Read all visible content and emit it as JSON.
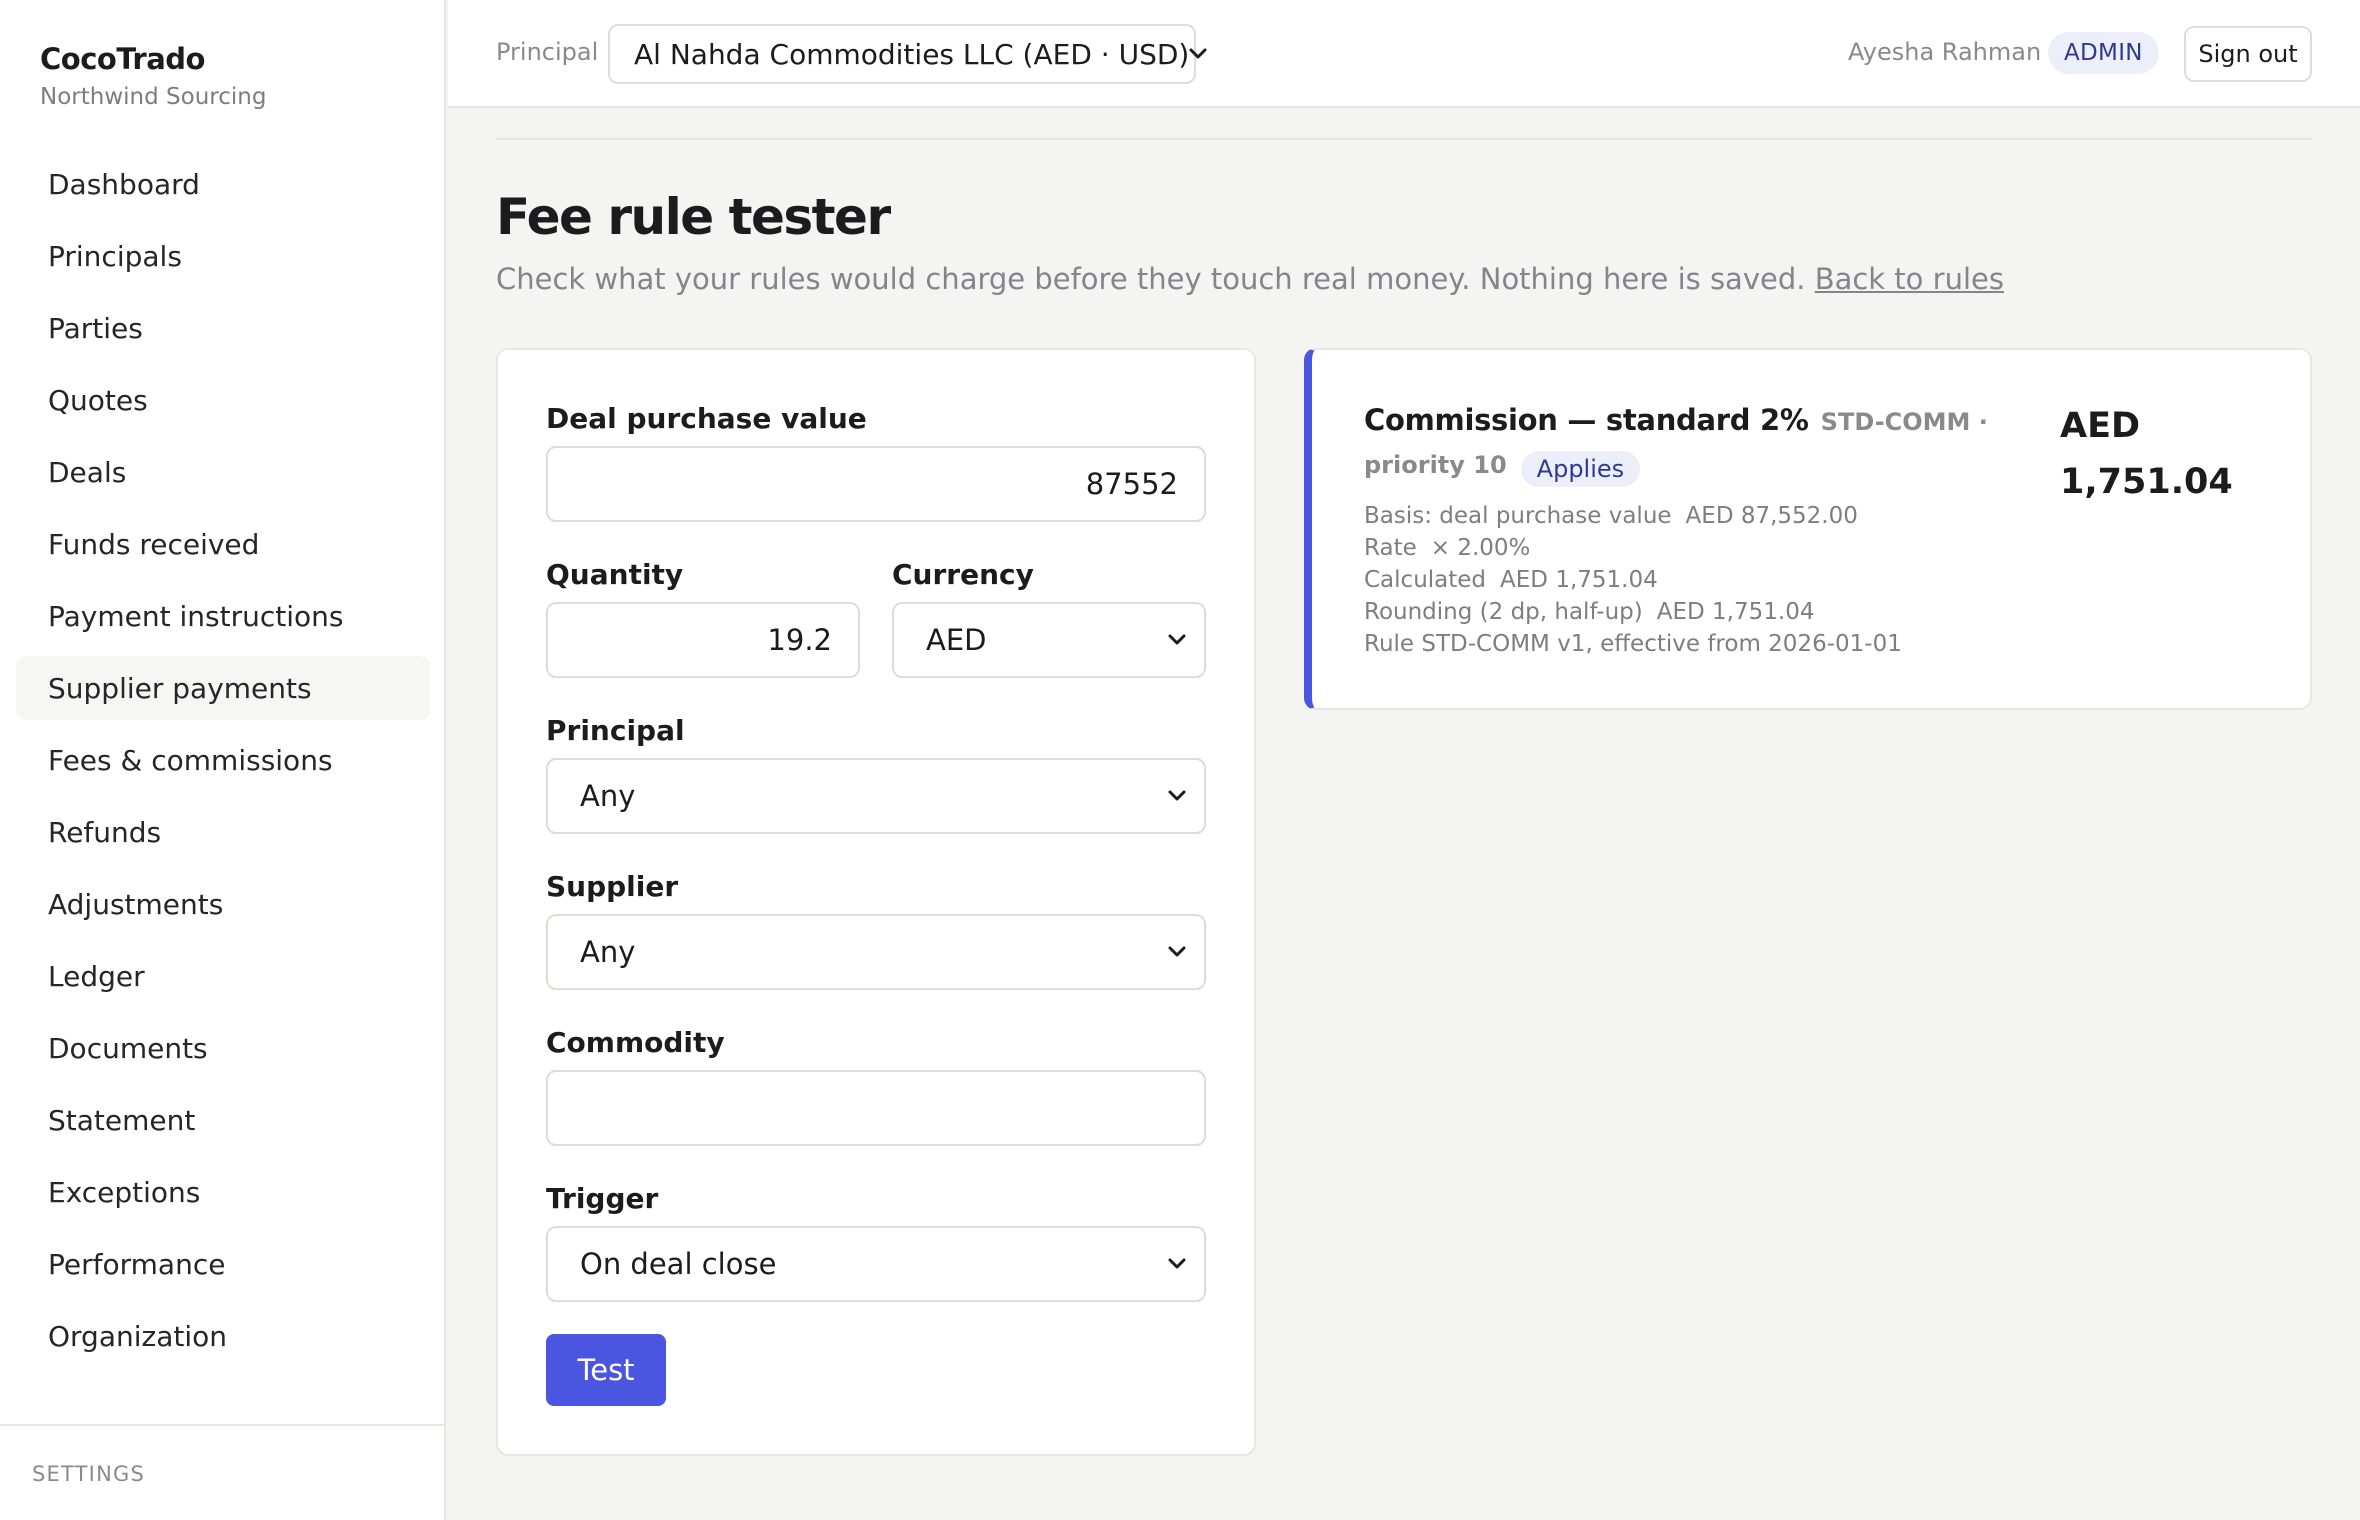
{
  "app": {
    "name": "CocoTrado",
    "org": "Northwind Sourcing"
  },
  "sidebar": {
    "items": [
      {
        "label": "Dashboard"
      },
      {
        "label": "Principals"
      },
      {
        "label": "Parties"
      },
      {
        "label": "Quotes"
      },
      {
        "label": "Deals"
      },
      {
        "label": "Funds received"
      },
      {
        "label": "Payment instructions"
      },
      {
        "label": "Supplier payments",
        "active": true
      },
      {
        "label": "Fees & commissions"
      },
      {
        "label": "Refunds"
      },
      {
        "label": "Adjustments"
      },
      {
        "label": "Ledger"
      },
      {
        "label": "Documents"
      },
      {
        "label": "Statement"
      },
      {
        "label": "Exceptions"
      },
      {
        "label": "Performance"
      },
      {
        "label": "Organization"
      }
    ],
    "footer_label": "SETTINGS"
  },
  "topbar": {
    "principal_label": "Principal",
    "principal_value": "Al Nahda Commodities LLC (AED · USD)",
    "user_name": "Ayesha Rahman",
    "role": "ADMIN",
    "signout_label": "Sign out"
  },
  "page": {
    "title": "Fee rule tester",
    "subtitle": "Check what your rules would charge before they touch real money. Nothing here is saved.",
    "back_link": "Back to rules"
  },
  "form": {
    "deal_value_label": "Deal purchase value",
    "deal_value": "87552",
    "quantity_label": "Quantity",
    "quantity": "19.2",
    "currency_label": "Currency",
    "currency": "AED",
    "principal_label": "Principal",
    "principal": "Any",
    "supplier_label": "Supplier",
    "supplier": "Any",
    "commodity_label": "Commodity",
    "commodity": "",
    "trigger_label": "Trigger",
    "trigger": "On deal close",
    "test_label": "Test"
  },
  "result": {
    "rule_name": "Commission — standard 2%",
    "rule_meta": "STD-COMM · priority 10",
    "status": "Applies",
    "basis_label": "Basis: deal purchase value",
    "basis_value": "AED 87,552.00",
    "rate_label": "Rate",
    "rate_value": "× 2.00%",
    "calc_label": "Calculated",
    "calc_value": "AED 1,751.04",
    "rounding_label": "Rounding (2 dp, half-up)",
    "rounding_value": "AED 1,751.04",
    "rule_version": "Rule STD-COMM v1, effective from 2026-01-01",
    "amount_currency": "AED",
    "amount_value": "1,751.04"
  },
  "colors": {
    "accent": "#4a55e0",
    "badge_bg": "#eceef9",
    "badge_text": "#2f3a8f"
  }
}
